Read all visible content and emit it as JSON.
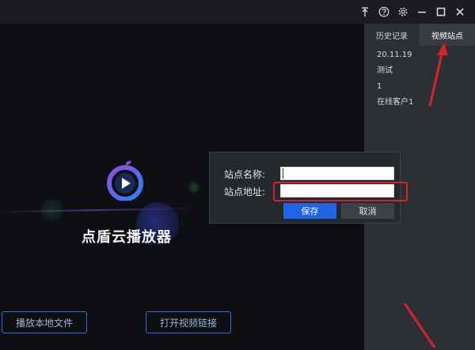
{
  "titlebar": {
    "icons": [
      "pin-icon",
      "help-icon",
      "gear-icon",
      "minimize-icon",
      "maximize-icon",
      "close-icon"
    ]
  },
  "player": {
    "brand": "点盾云播放器",
    "buttons": {
      "local_file": "播放本地文件",
      "open_link": "打开视频链接"
    }
  },
  "sidepanel": {
    "tabs": [
      {
        "label": "历史记录",
        "active": false
      },
      {
        "label": "视频站点",
        "active": true
      }
    ],
    "items": [
      "20.11.19",
      "测试",
      "1",
      "在线客户1"
    ]
  },
  "dialog": {
    "name_label": "站点名称:",
    "address_label": "站点地址:",
    "name_value": "",
    "address_value": "",
    "save_label": "保存",
    "cancel_label": "取消"
  },
  "colors": {
    "accent": "#1f63e6",
    "annotation": "#d3242a",
    "panel": "#2c2f33",
    "background": "#0d0f12"
  }
}
